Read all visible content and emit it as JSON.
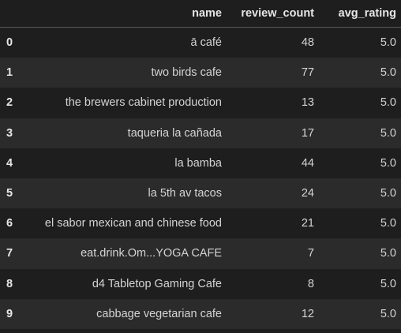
{
  "columns": [
    "",
    "name",
    "review_count",
    "avg_rating"
  ],
  "rows": [
    {
      "index": "0",
      "name": "ā café",
      "review_count": "48",
      "avg_rating": "5.0"
    },
    {
      "index": "1",
      "name": "two birds cafe",
      "review_count": "77",
      "avg_rating": "5.0"
    },
    {
      "index": "2",
      "name": "the brewers cabinet production",
      "review_count": "13",
      "avg_rating": "5.0"
    },
    {
      "index": "3",
      "name": "taqueria la cañada",
      "review_count": "17",
      "avg_rating": "5.0"
    },
    {
      "index": "4",
      "name": "la bamba",
      "review_count": "44",
      "avg_rating": "5.0"
    },
    {
      "index": "5",
      "name": "la 5th av tacos",
      "review_count": "24",
      "avg_rating": "5.0"
    },
    {
      "index": "6",
      "name": "el sabor mexican and chinese food",
      "review_count": "21",
      "avg_rating": "5.0"
    },
    {
      "index": "7",
      "name": "eat.drink.Om...YOGA CAFE",
      "review_count": "7",
      "avg_rating": "5.0"
    },
    {
      "index": "8",
      "name": "d4 Tabletop Gaming Cafe",
      "review_count": "8",
      "avg_rating": "5.0"
    },
    {
      "index": "9",
      "name": "cabbage vegetarian cafe",
      "review_count": "12",
      "avg_rating": "5.0"
    }
  ]
}
